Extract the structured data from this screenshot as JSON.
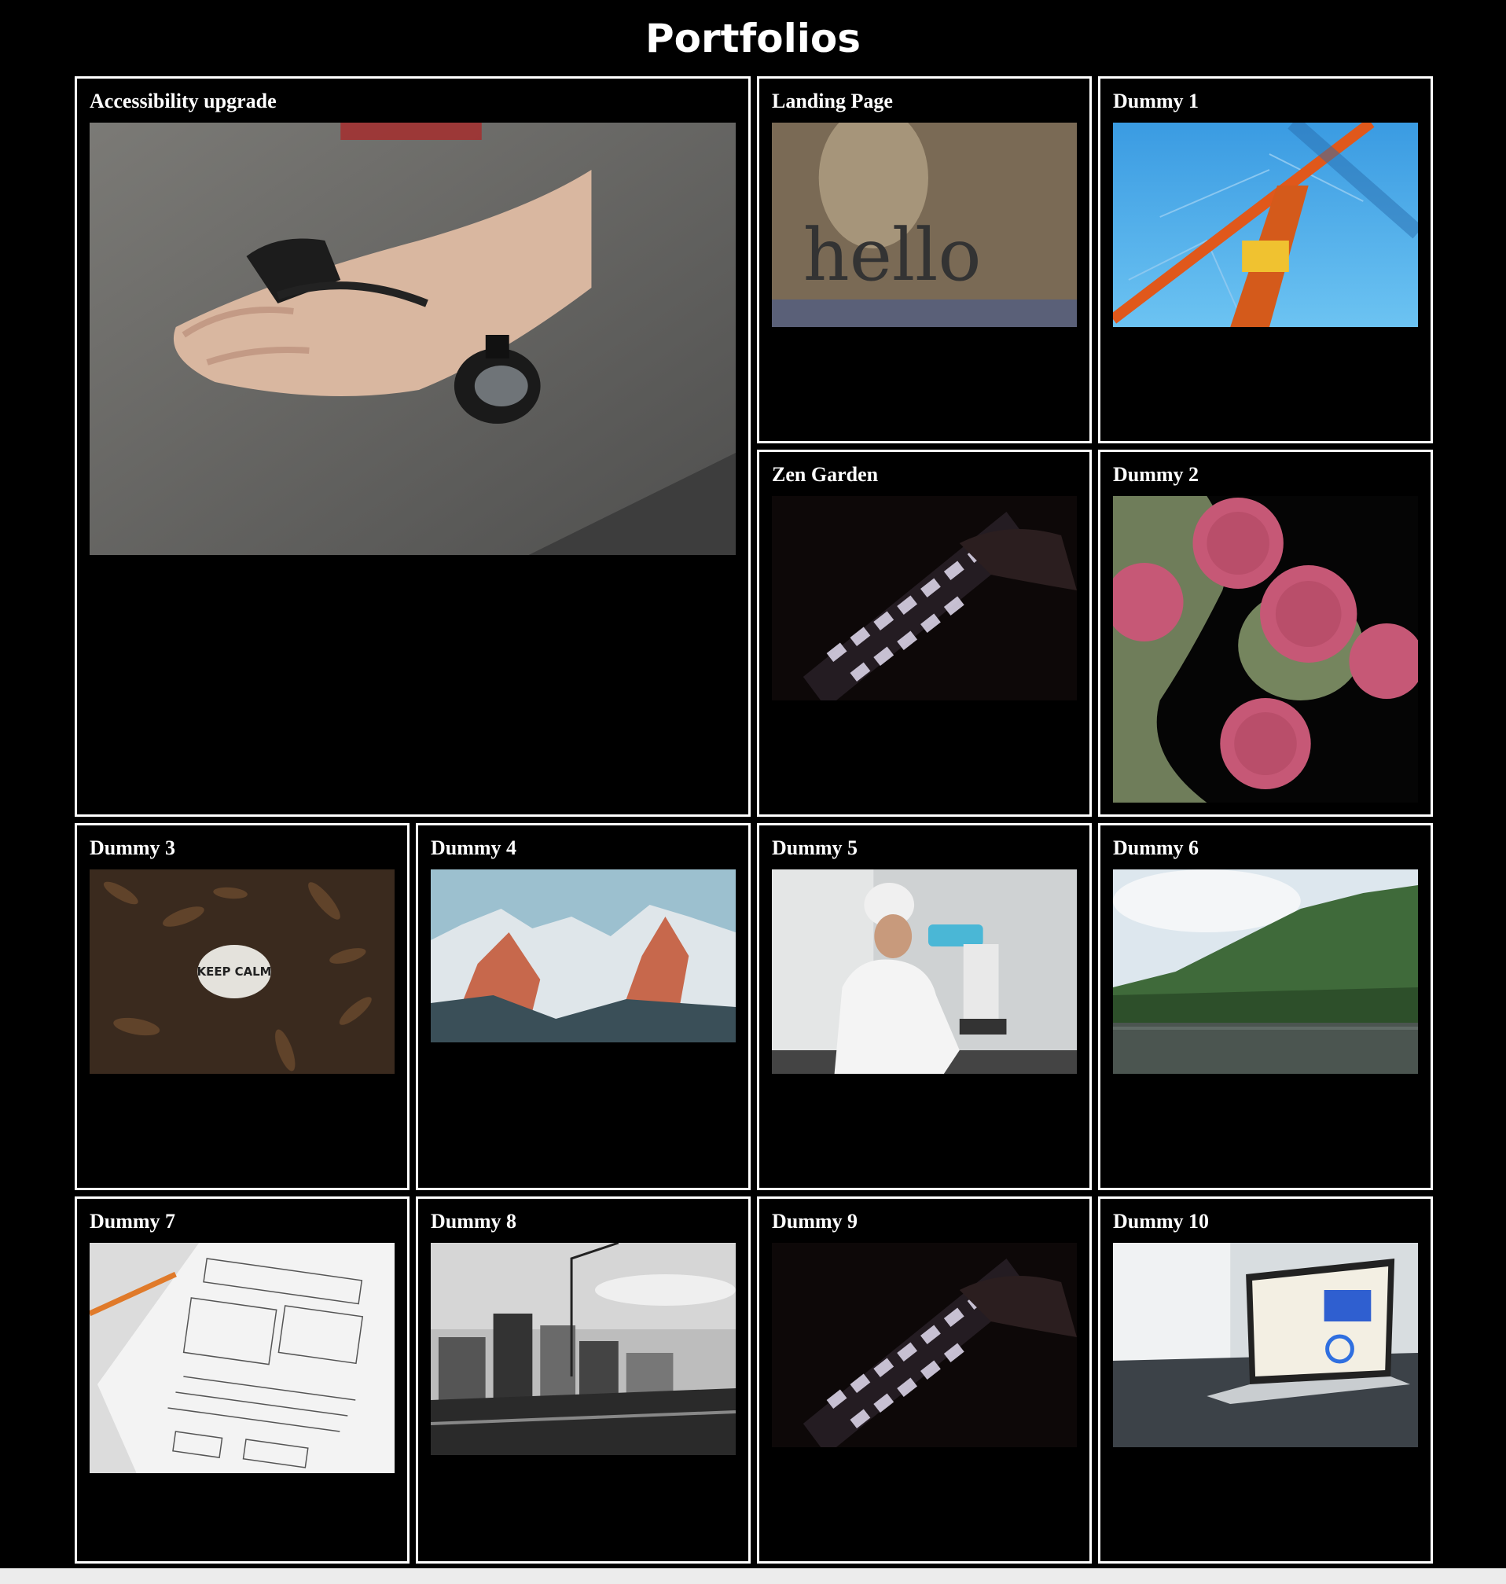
{
  "page": {
    "title": "Portfolios"
  },
  "portfolios": [
    {
      "title": "Accessibility upgrade",
      "image": "hand-wearable-ring-photo"
    },
    {
      "title": "Landing Page",
      "image": "hello-doormat-photo"
    },
    {
      "title": "Dummy 1",
      "image": "construction-crane-photo"
    },
    {
      "title": "Zen Garden",
      "image": "backlit-keyboard-photo"
    },
    {
      "title": "Dummy 2",
      "image": "microscopic-cells-photo"
    },
    {
      "title": "Dummy 3",
      "image": "keep-calm-rock-photo"
    },
    {
      "title": "Dummy 4",
      "image": "snowy-mountains-photo"
    },
    {
      "title": "Dummy 5",
      "image": "scientist-microscope-photo"
    },
    {
      "title": "Dummy 6",
      "image": "forest-lake-photo"
    },
    {
      "title": "Dummy 7",
      "image": "wireframe-sketch-photo"
    },
    {
      "title": "Dummy 8",
      "image": "city-construction-bw-photo"
    },
    {
      "title": "Dummy 9",
      "image": "backlit-keyboard-photo"
    },
    {
      "title": "Dummy 10",
      "image": "laptop-dashboard-photo"
    }
  ],
  "photo_text": {
    "doormat": "hello",
    "rock": "KEEP CALM"
  }
}
